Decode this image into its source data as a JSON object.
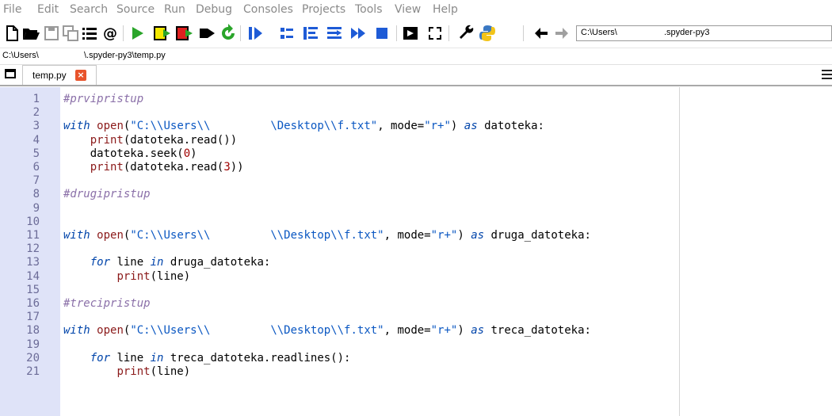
{
  "menu": [
    "File",
    "Edit",
    "Search",
    "Source",
    "Run",
    "Debug",
    "Consoles",
    "Projects",
    "Tools",
    "View",
    "Help"
  ],
  "toolbar": {
    "working_dir_prefix": "C:\\Users\\",
    "working_dir_suffix": ".spyder-py3"
  },
  "file_path": {
    "prefix": "C:\\Users\\",
    "suffix": "\\.spyder-py3\\temp.py"
  },
  "tab": {
    "label": "temp.py",
    "close_symbol": "×"
  },
  "colors": {
    "gutter": "#dfe3f8",
    "comment": "#8a6fa8",
    "keyword": "#0044aa",
    "builtin": "#8b1a1a",
    "string": "#0a57c2",
    "run_green": "#2aa52a",
    "stop_blue": "#1e5bd6"
  },
  "code_lines": [
    {
      "n": "1",
      "text": "#prvipristup"
    },
    {
      "n": "2",
      "text": ""
    },
    {
      "n": "3",
      "text": "with open(\"C:\\\\Users\\\\         \\Desktop\\\\f.txt\", mode=\"r+\") as datoteka:"
    },
    {
      "n": "4",
      "text": "    print(datoteka.read())"
    },
    {
      "n": "5",
      "text": "    datoteka.seek(0)"
    },
    {
      "n": "6",
      "text": "    print(datoteka.read(3))"
    },
    {
      "n": "7",
      "text": ""
    },
    {
      "n": "8",
      "text": "#drugipristup"
    },
    {
      "n": "9",
      "text": ""
    },
    {
      "n": "10",
      "text": ""
    },
    {
      "n": "11",
      "text": "with open(\"C:\\\\Users\\\\         \\\\Desktop\\\\f.txt\", mode=\"r+\") as druga_datoteka:"
    },
    {
      "n": "12",
      "text": ""
    },
    {
      "n": "13",
      "text": "    for line in druga_datoteka:"
    },
    {
      "n": "14",
      "text": "        print(line)"
    },
    {
      "n": "15",
      "text": ""
    },
    {
      "n": "16",
      "text": "#trecipristup"
    },
    {
      "n": "17",
      "text": ""
    },
    {
      "n": "18",
      "text": "with open(\"C:\\\\Users\\\\         \\\\Desktop\\\\f.txt\", mode=\"r+\") as treca_datoteka:"
    },
    {
      "n": "19",
      "text": ""
    },
    {
      "n": "20",
      "text": "    for line in treca_datoteka.readlines():"
    },
    {
      "n": "21",
      "text": "        print(line)"
    }
  ]
}
